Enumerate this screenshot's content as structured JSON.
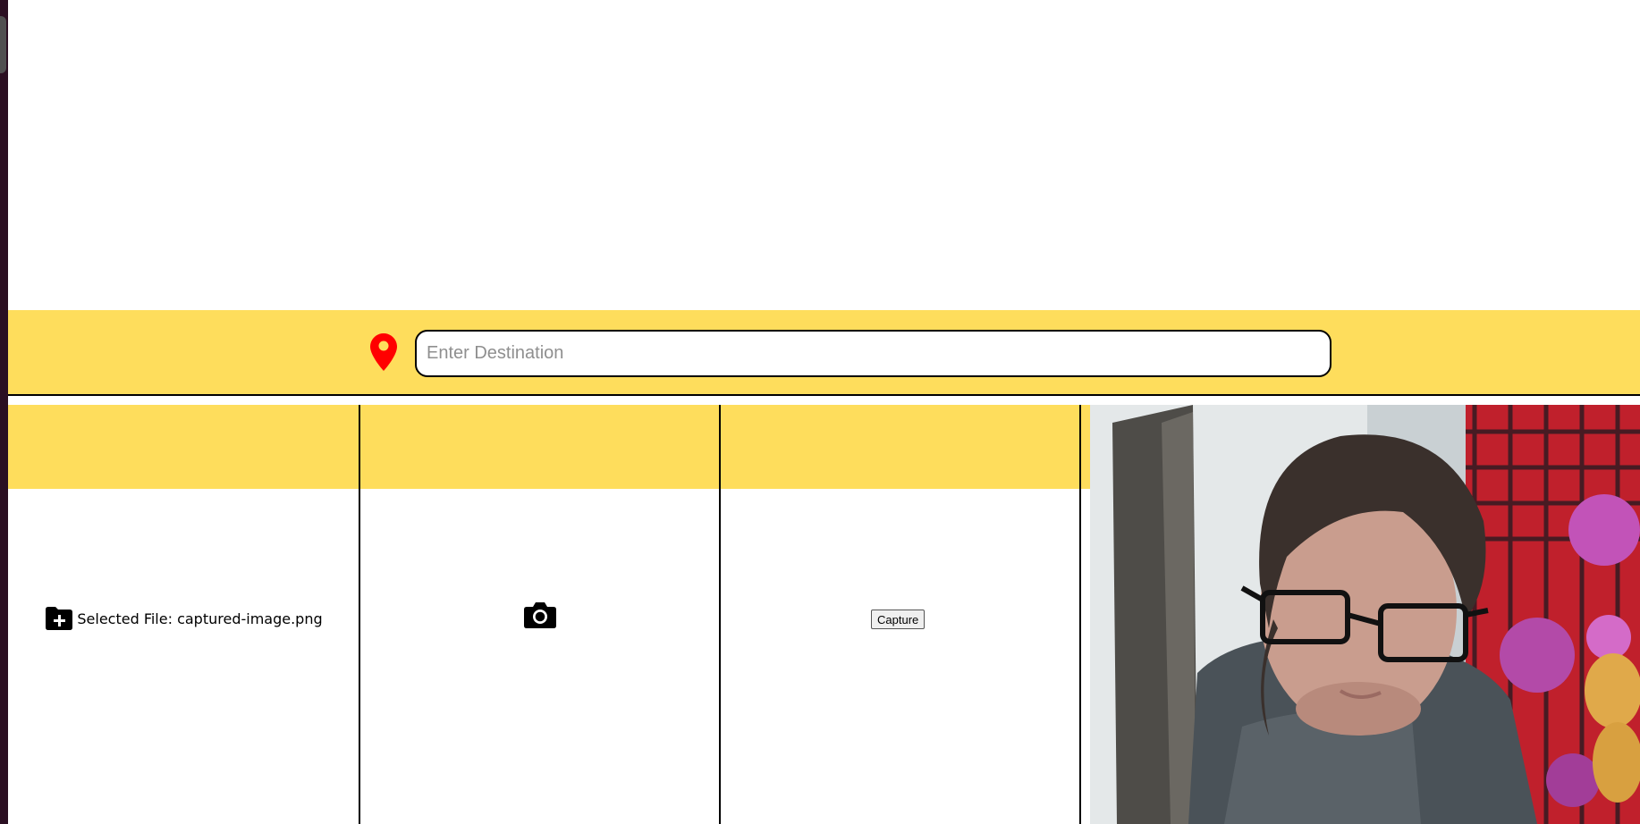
{
  "destination": {
    "placeholder": "Enter Destination",
    "value": "",
    "pin_icon": "map-pin-icon",
    "pin_color": "#ff0000"
  },
  "upload": {
    "icon": "folder-plus-icon",
    "label": "Selected File: captured-image.png"
  },
  "camera": {
    "icon": "camera-icon"
  },
  "capture": {
    "label": "Capture"
  },
  "colors": {
    "accent_yellow": "#fedd5c",
    "border": "#000000"
  }
}
